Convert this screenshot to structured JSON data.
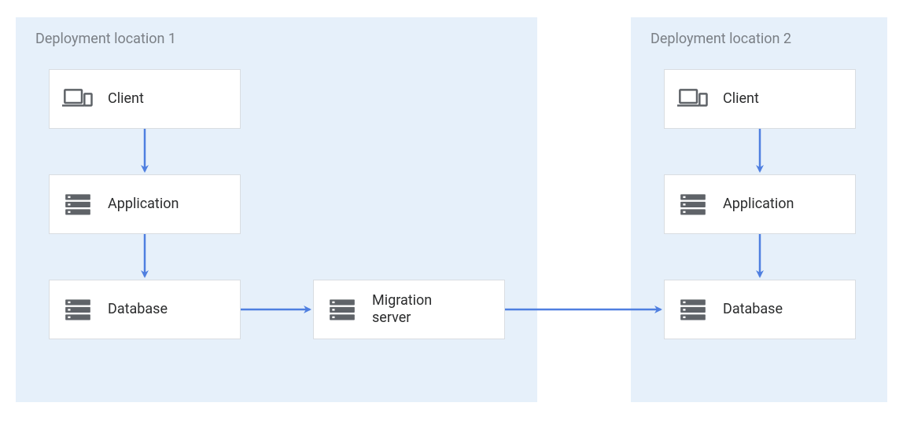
{
  "zones": {
    "loc1": {
      "title": "Deployment location 1"
    },
    "loc2": {
      "title": "Deployment location 2"
    }
  },
  "nodes": {
    "client1": {
      "label": "Client"
    },
    "app1": {
      "label": "Application"
    },
    "db1": {
      "label": "Database"
    },
    "migration": {
      "label": "Migration\nserver"
    },
    "client2": {
      "label": "Client"
    },
    "app2": {
      "label": "Application"
    },
    "db2": {
      "label": "Database"
    }
  },
  "arrows": [
    {
      "from": "client1",
      "to": "app1"
    },
    {
      "from": "app1",
      "to": "db1"
    },
    {
      "from": "db1",
      "to": "migration"
    },
    {
      "from": "migration",
      "to": "db2"
    },
    {
      "from": "client2",
      "to": "app2"
    },
    {
      "from": "app2",
      "to": "db2"
    }
  ],
  "colors": {
    "arrow": "#4f7fe0",
    "zone_bg": "#e6f0fa",
    "node_border": "#d9dde1",
    "icon": "#5f6368"
  }
}
